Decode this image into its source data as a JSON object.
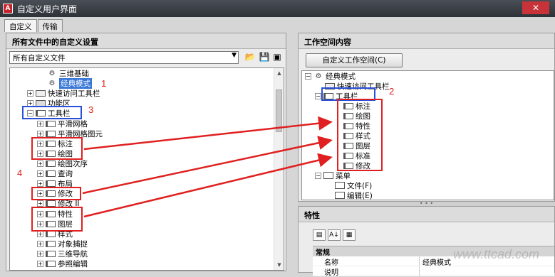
{
  "window": {
    "title": "自定义用户界面",
    "close_label": "✕"
  },
  "tabs": [
    {
      "label": "自定义"
    },
    {
      "label": "传输"
    }
  ],
  "left": {
    "header": "所有文件中的自定义设置",
    "combo_value": "所有自定义文件",
    "tree": [
      {
        "label": "三维基础",
        "icon": "gear-icon"
      },
      {
        "label": "经典模式",
        "icon": "gear-icon",
        "selected": true
      },
      {
        "label": "快速访问工具栏"
      },
      {
        "label": "功能区"
      },
      {
        "label": "工具栏"
      },
      {
        "label": "平滑网格"
      },
      {
        "label": "平滑网格图元"
      },
      {
        "label": "标注"
      },
      {
        "label": "绘图"
      },
      {
        "label": "绘图次序"
      },
      {
        "label": "查询"
      },
      {
        "label": "布局"
      },
      {
        "label": "修改"
      },
      {
        "label": "修改 II"
      },
      {
        "label": "特性"
      },
      {
        "label": "图层"
      },
      {
        "label": "样式"
      },
      {
        "label": "对象捕捉"
      },
      {
        "label": "三维导航"
      },
      {
        "label": "参照编辑"
      }
    ]
  },
  "right": {
    "header": "工作空间内容",
    "customize_button": "自定义工作空间(C)",
    "tree": [
      {
        "label": "经典模式"
      },
      {
        "label": "快速访问工具栏"
      },
      {
        "label": "工具栏"
      },
      {
        "label": "标注"
      },
      {
        "label": "绘图"
      },
      {
        "label": "特性"
      },
      {
        "label": "样式"
      },
      {
        "label": "图层"
      },
      {
        "label": "标准"
      },
      {
        "label": "修改"
      },
      {
        "label": "菜单"
      },
      {
        "label": "文件(F)"
      },
      {
        "label": "编辑(E)"
      }
    ]
  },
  "properties": {
    "header": "特性",
    "category": "常规",
    "rows": [
      {
        "key": "名称",
        "value": "经典模式"
      },
      {
        "key": "说明",
        "value": ""
      }
    ]
  },
  "annotations": {
    "n1": "1",
    "n2": "2",
    "n3": "3",
    "n4": "4",
    "color": "#e02020",
    "box_color": "#2b4fd8"
  },
  "watermark": "www.ttcad.com"
}
